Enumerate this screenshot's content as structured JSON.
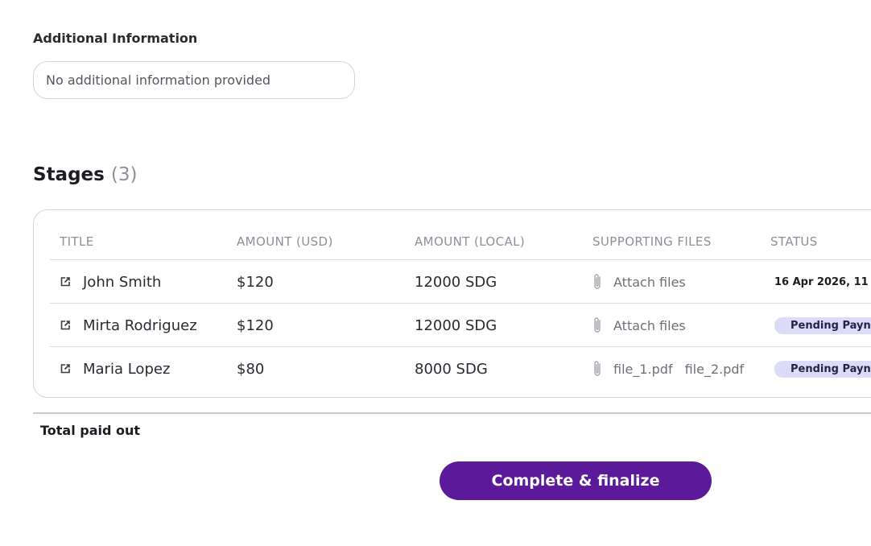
{
  "additional_info": {
    "label": "Additional Information",
    "value": "No additional information provided"
  },
  "stages": {
    "title": "Stages",
    "count": "(3)",
    "columns": {
      "title": "TITLE",
      "amount_usd": "AMOUNT (USD)",
      "amount_local": "AMOUNT (LOCAL)",
      "supporting_files": "SUPPORTING FILES",
      "status": "STATUS"
    },
    "rows": [
      {
        "title": "John Smith",
        "amount_usd": "$120",
        "amount_local": "12000 SDG",
        "files": [
          "Attach files"
        ],
        "status": "16 Apr 2026, 11"
      },
      {
        "title": "Mirta Rodriguez",
        "amount_usd": "$120",
        "amount_local": "12000 SDG",
        "files": [
          "Attach files"
        ],
        "status": "Pending Payn"
      },
      {
        "title": "Maria Lopez",
        "amount_usd": "$80",
        "amount_local": "8000 SDG",
        "files": [
          "file_1.pdf",
          "file_2.pdf"
        ],
        "status": "Pending Payn"
      }
    ]
  },
  "total_paid_out": {
    "label": "Total paid out"
  },
  "actions": {
    "finalize_label": "Complete & finalize"
  },
  "icons": {
    "row_link": "external-link-icon",
    "attachment": "paperclip-icon"
  },
  "colors": {
    "primary": "#5a1a9a",
    "badge_bg": "#dcdcf8",
    "border": "#d4d4dc"
  }
}
